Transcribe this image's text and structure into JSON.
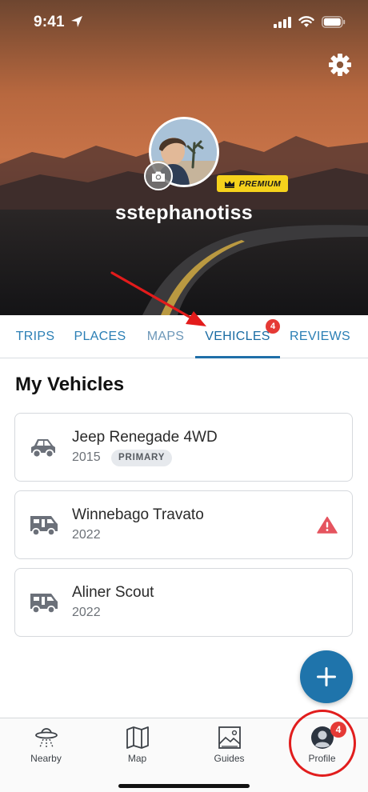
{
  "status_bar": {
    "time": "9:41"
  },
  "profile": {
    "username": "sstephanotiss",
    "badge": "PREMIUM"
  },
  "tabs": [
    {
      "label": "TRIPS"
    },
    {
      "label": "PLACES"
    },
    {
      "label": "MAPS"
    },
    {
      "label": "VEHICLES",
      "badge": "4",
      "active": true
    },
    {
      "label": "REVIEWS"
    }
  ],
  "section": {
    "title": "My Vehicles"
  },
  "vehicles": [
    {
      "name": "Jeep Renegade 4WD",
      "year": "2015",
      "tag": "PRIMARY",
      "icon": "car-icon"
    },
    {
      "name": "Winnebago Travato",
      "year": "2022",
      "icon": "rv-icon",
      "warning": true
    },
    {
      "name": "Aliner Scout",
      "year": "2022",
      "icon": "rv-icon"
    }
  ],
  "bottom_nav": [
    {
      "label": "Nearby",
      "icon": "ufo-icon"
    },
    {
      "label": "Map",
      "icon": "map-icon"
    },
    {
      "label": "Guides",
      "icon": "guides-icon"
    },
    {
      "label": "Profile",
      "icon": "profile-icon",
      "badge": "4",
      "active": true
    }
  ],
  "colors": {
    "accent": "#1f74ab",
    "tab_text": "#2b7fb5",
    "badge": "#e53935",
    "premium": "#f5d21c"
  }
}
